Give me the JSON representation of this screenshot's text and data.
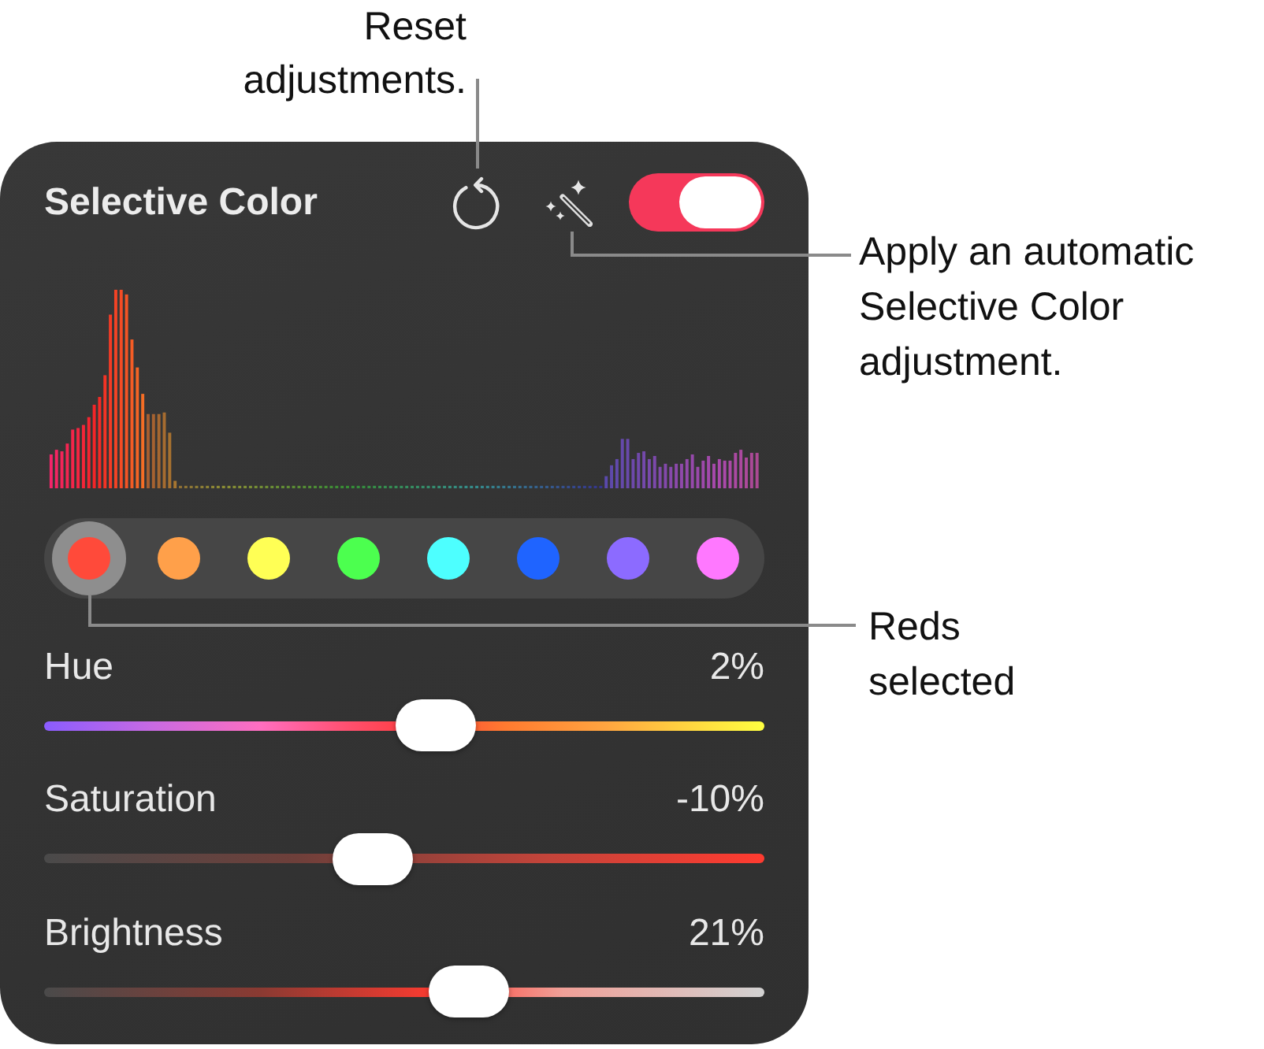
{
  "annotations": {
    "reset": "Reset adjustments.",
    "auto": "Apply an automatic Selective Color adjustment.",
    "selected_color": "Reds selected"
  },
  "panel": {
    "title": "Selective Color",
    "enabled": true
  },
  "swatches": [
    {
      "color": "#ff4a3a",
      "selected": true
    },
    {
      "color": "#ffa04a",
      "selected": false
    },
    {
      "color": "#ffff55",
      "selected": false
    },
    {
      "color": "#4cff4f",
      "selected": false
    },
    {
      "color": "#4dffff",
      "selected": false
    },
    {
      "color": "#1f64ff",
      "selected": false
    },
    {
      "color": "#8c6bff",
      "selected": false
    },
    {
      "color": "#ff78ff",
      "selected": false
    }
  ],
  "sliders": [
    {
      "kind": "hue",
      "label": "Hue",
      "reading": "2%",
      "level": 0.55
    },
    {
      "kind": "saturation",
      "label": "Saturation",
      "reading": "-10%",
      "level": 0.45
    },
    {
      "kind": "brightness",
      "label": "Brightness",
      "reading": "21%",
      "level": 0.6
    }
  ]
}
